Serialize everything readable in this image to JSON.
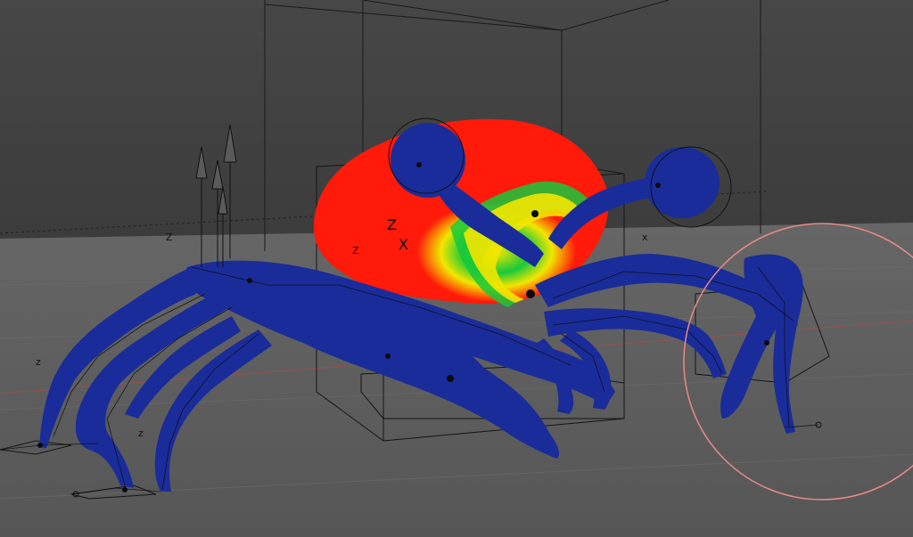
{
  "viewport": {
    "name": "3d-viewport",
    "mode": "weight-paint",
    "colors": {
      "wall": "#4a4a4a",
      "floor": "#5f5f5f",
      "weight_high": "#ff1a0a",
      "weight_mid": "#f2e600",
      "weight_lowmid": "#18c93a",
      "weight_low": "#1a2c9a",
      "bone_lines": "#111111",
      "brush_cursor": "#e88a8a",
      "axis_x": "#b24a4a",
      "axis_y": "#6f8f3f"
    }
  },
  "axis_labels": {
    "z1": "Z",
    "z2": "Z",
    "z3": "z",
    "z4": "z",
    "z5": "Z",
    "x1": "X",
    "x2": "x"
  },
  "weights": {
    "shell_peak": 1.0,
    "legs": 0.0
  }
}
